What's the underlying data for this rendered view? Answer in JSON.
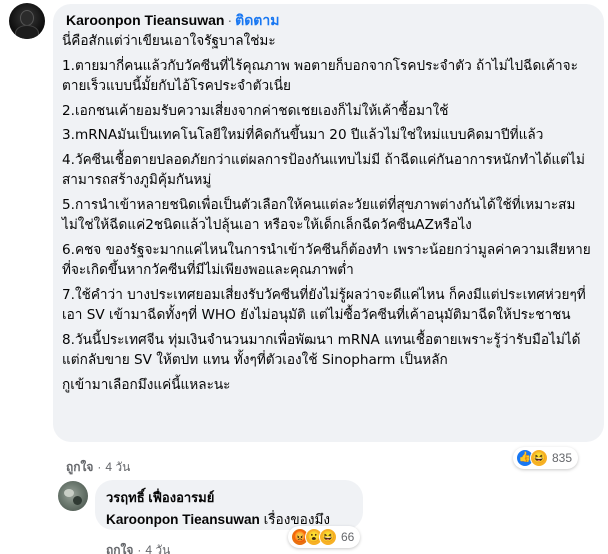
{
  "comment": {
    "author": "Karoonpon Tieansuwan",
    "separator": "·",
    "follow_label": "ติดตาม",
    "paragraphs": [
      "นี่คือสักแต่ว่าเขียนเอาใจรัฐบาลใช่มะ",
      "1.ตายมากี่คนแล้วกับวัคซีนที่ไร้คุณภาพ พอตายก็บอกจากโรคประจำตัว ถ้าไม่ไปฉีดเค้าจะตายเร็วแบบนี้มั้ยกับไอ้โรคประจำตัวเนี่ย",
      "2.เอกชนเค้ายอมรับความเสี่ยงจากค่าชดเชยเองก็ไม่ให้เค้าซื้อมาใช้",
      "3.mRNAมันเป็นเทคโนโลยีใหม่ที่คิดกันขึ้นมา 20 ปีแล้วไม่ใช่ใหม่แบบคิดมาปีที่แล้ว",
      "4.วัคซีนเชื้อตายปลอดภัยกว่าแต่ผลการป้องกันแทบไม่มี ถ้าฉีดแค่กันอาการหนักทำได้แต่ไม่สามารถสร้างภูมิคุ้มกันหมู่",
      "5.การนำเข้าหลายชนิดเพื่อเป็นตัวเลือกให้คนแต่ละวัยแต่ที่สุขภาพต่างกันได้ใช้ที่เหมาะสมไม่ใช่ให้ฉีดแค่2ชนิดแล้วไปลุ้นเอา หรือจะให้เด็กเล็กฉีดวัคซีนAZหรือไง",
      "6.คชจ ของรัฐจะมากแค่ไหนในการนำเข้าวัคซีนก็ต้องทำ เพราะน้อยกว่ามูลค่าความเสียหายที่จะเกิดขึ้นหากวัคซีนที่มีไม่เพียงพอและคุณภาพต่ำ",
      "7.ใช้คำว่า บางประเทศยอมเสี่ยงรับวัคซีนที่ยังไม่รู้ผลว่าจะดีแค่ไหน ก็คงมีแต่ประเทศห่วยๆที่เอา SV เข้ามาฉีดทั้งๆที่ WHO ยังไม่อนุมัติ แต่ไม่ซื้อวัคซีนที่เค้าอนุมัติมาฉีดให้ประชาชน",
      "8.วันนี้ประเทศจีน ทุ่มเงินจำนวนมากเพื่อพัฒนา mRNA แทนเชื้อตายเพราะรู้ว่ารับมือไม่ได้ แต่กลับขาย SV ให้ตปท แทน ทั้งๆที่ตัวเองใช้ Sinopharm เป็นหลัก",
      "กูเข้ามาเลือกมึงแค่นี้แหละนะ"
    ],
    "like_label": "ถูกใจ",
    "time": "4 วัน",
    "reaction_count": "835",
    "reaction_icons": [
      "like-icon",
      "haha-icon"
    ]
  },
  "reply": {
    "author": "วรฤทธิ์ เฟื่องอารมย์",
    "tagged_name": "Karoonpon Tieansuwan",
    "text": "เรื่องของมึง",
    "like_label": "ถูกใจ",
    "time": "4 วัน",
    "reaction_count": "66",
    "reaction_icons": [
      "angry-icon",
      "wow-icon",
      "haha-icon"
    ]
  },
  "colors": {
    "bubble": "#f0f2f5",
    "link": "#1877f2",
    "meta": "#65676b"
  }
}
